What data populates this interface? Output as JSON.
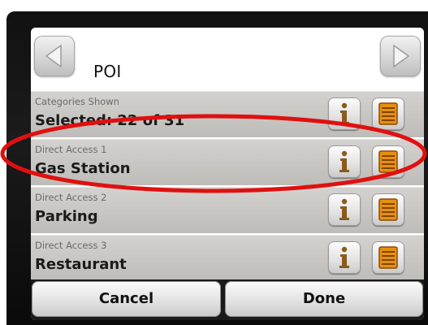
{
  "header": {
    "title": "POI",
    "prev_icon": "chevron-left-icon",
    "next_icon": "chevron-right-icon"
  },
  "rows": [
    {
      "caption": "Categories Shown",
      "value": "Selected: 22 of 31"
    },
    {
      "caption": "Direct Access 1",
      "value": "Gas Station"
    },
    {
      "caption": "Direct Access 2",
      "value": "Parking"
    },
    {
      "caption": "Direct Access 3",
      "value": "Restaurant"
    }
  ],
  "row_icons": {
    "info": "info-icon",
    "list": "list-icon"
  },
  "footer": {
    "cancel_label": "Cancel",
    "done_label": "Done"
  },
  "colors": {
    "highlight": "#e01010",
    "icon_orange": "#e8900e",
    "info_brown": "#8b5a1e"
  }
}
